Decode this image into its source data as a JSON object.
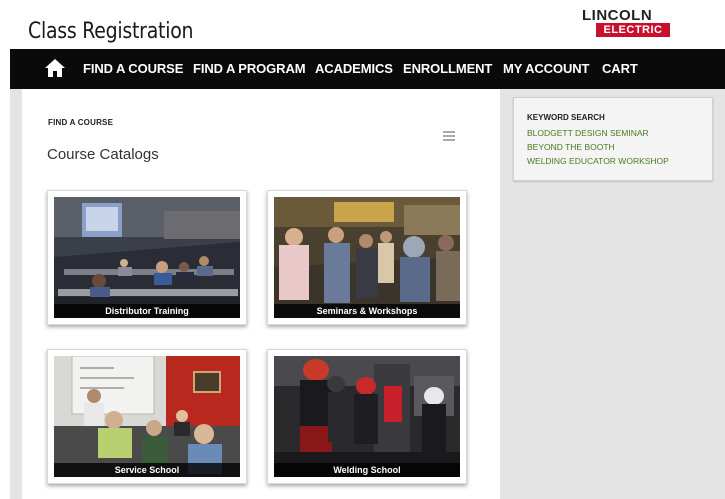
{
  "header": {
    "title": "Class Registration",
    "logo_top": "LINCOLN",
    "logo_bottom": "ELECTRIC"
  },
  "nav": {
    "home_icon": "home-icon",
    "items": [
      "FIND A COURSE",
      "FIND A PROGRAM",
      "ACADEMICS",
      "ENROLLMENT",
      "MY ACCOUNT",
      "CART"
    ]
  },
  "main": {
    "breadcrumb": "FIND A COURSE",
    "title": "Course Catalogs",
    "menu_icon": "hamburger-menu-icon",
    "cards": [
      {
        "caption": "Distributor Training"
      },
      {
        "caption": "Seminars & Workshops"
      },
      {
        "caption": "Service School"
      },
      {
        "caption": "Welding School"
      }
    ]
  },
  "sidebar": {
    "heading": "KEYWORD SEARCH",
    "links": [
      "BLODGETT DESIGN SEMINAR",
      "BEYOND THE BOOTH",
      "WELDING EDUCATOR WORKSHOP"
    ]
  },
  "colors": {
    "nav_bg": "#0a0a0a",
    "brand_red": "#c8102e",
    "link_green": "#4a7a1e",
    "page_gray": "#e4e4e4"
  }
}
